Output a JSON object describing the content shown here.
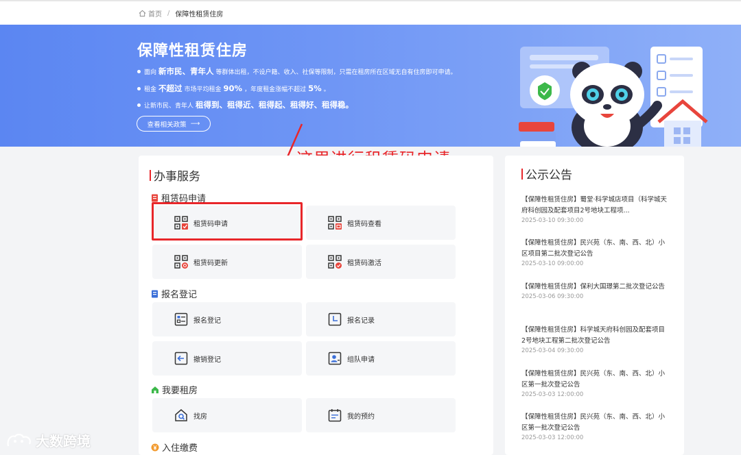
{
  "breadcrumb": {
    "home": "首页",
    "separator": "/",
    "current": "保障性租赁住房"
  },
  "banner": {
    "title": "保障性租赁住房",
    "line1": {
      "a": "面向",
      "b": "新市民、青年人",
      "c": "等群体出租，不设户籍、收入、社保等限制，只需在租房所在区域无自有住房即可申请。"
    },
    "line2": {
      "a": "租金",
      "b": "不超过",
      "c": "市场平均租金",
      "d": "90%",
      "e": "，年度租金涨幅不超过",
      "f": "5%",
      "g": "。"
    },
    "line3": {
      "a": "让新市民、青年人",
      "b": "租得到、租得近、租得起、租得好、租得稳。"
    },
    "policy_button": "查看相关政策",
    "policy_arrow": "⟶"
  },
  "annotation": {
    "text": "这里进行租赁码申请"
  },
  "services": {
    "title": "办事服务",
    "sections": [
      {
        "title": "租赁码申请",
        "icon": "document-red-icon",
        "items": [
          "租赁码申请",
          "租赁码查看",
          "租赁码更新",
          "租赁码激活"
        ]
      },
      {
        "title": "报名登记",
        "icon": "document-blue-icon",
        "items": [
          "报名登记",
          "报名记录",
          "撤销登记",
          "组队申请"
        ]
      },
      {
        "title": "我要租房",
        "icon": "house-green-icon",
        "items": [
          "找房",
          "我的预约"
        ]
      },
      {
        "title": "入住缴费",
        "icon": "yen-orange-icon",
        "items": []
      }
    ]
  },
  "notices": {
    "title": "公示公告",
    "items": [
      {
        "title": "【保障性租赁住房】蜀堂·科学城店项目（科学城天府科创园及配套项目2号地块工程项...",
        "date": "2025-03-10 09:30:00"
      },
      {
        "title": "【保障性租赁住房】民兴苑（东、南、西、北）小区项目第二批次登记公告",
        "date": "2025-03-10 09:00:00"
      },
      {
        "title": "【保障性租赁住房】保利大国璟第二批次登记公告",
        "date": "2025-03-06 09:30:00"
      },
      {
        "title": "【保障性租赁住房】科学城天府科创园及配套项目2号地块工程第二批次登记公告",
        "date": "2025-03-04 09:30:00"
      },
      {
        "title": "【保障性租赁住房】民兴苑（东、南、西、北）小区第一批次登记公告",
        "date": "2025-03-03 12:00:00"
      },
      {
        "title": "【保障性租赁住房】民兴苑（东、南、西、北）小区第一批次登记公告",
        "date": "2025-03-03 12:00:00"
      }
    ]
  },
  "watermark": {
    "text": "大数跨境"
  },
  "colors": {
    "accent_red": "#e8262a",
    "banner_blue": "#6f96f5",
    "icon_blue": "#3b6fd8"
  }
}
